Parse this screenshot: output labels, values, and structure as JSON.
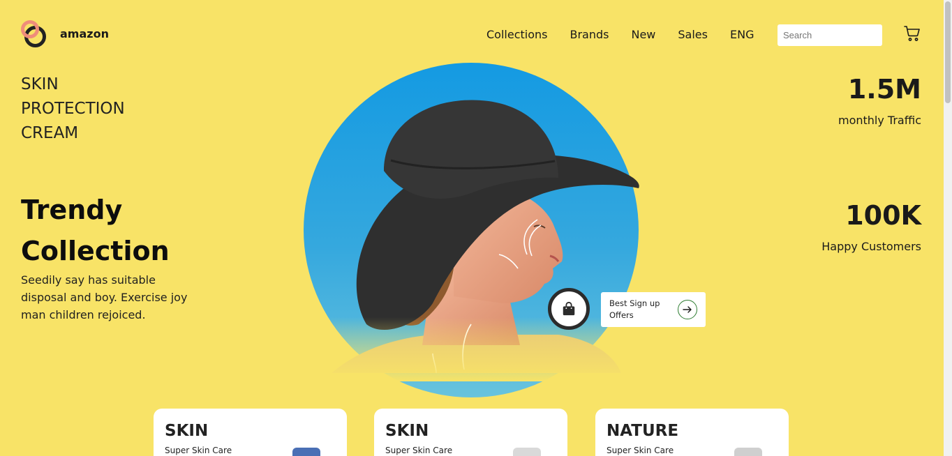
{
  "header": {
    "brand": "amazon",
    "nav": [
      "Collections",
      "Brands",
      "New",
      "Sales",
      "ENG"
    ],
    "search_placeholder": "Search",
    "cart_icon": "cart-icon"
  },
  "hero": {
    "tagline": [
      "SKIN",
      "PROTECTION",
      "CREAM"
    ],
    "title": [
      "Trendy",
      "Collection"
    ],
    "description": "Seedily say has suitable disposal and boy. Exercise joy man children rejoiced.",
    "offer_text": "Best Sign up Offers",
    "bag_icon": "shopping-bag-icon",
    "arrow_icon": "arrow-right-icon"
  },
  "stats": [
    {
      "value": "1.5M",
      "label": "monthly Traffic"
    },
    {
      "value": "100K",
      "label": "Happy Customers"
    }
  ],
  "cards": [
    {
      "title": "SKIN",
      "subtitle": "Super Skin Care"
    },
    {
      "title": "SKIN",
      "subtitle": "Super Skin Care"
    },
    {
      "title": "NATURE",
      "subtitle": "Super Skin Care"
    }
  ],
  "colors": {
    "background": "#f8e367",
    "circle": "#149ae2",
    "logo_accent": "#ef8d7a",
    "arrow_accent": "#2e7d32"
  }
}
